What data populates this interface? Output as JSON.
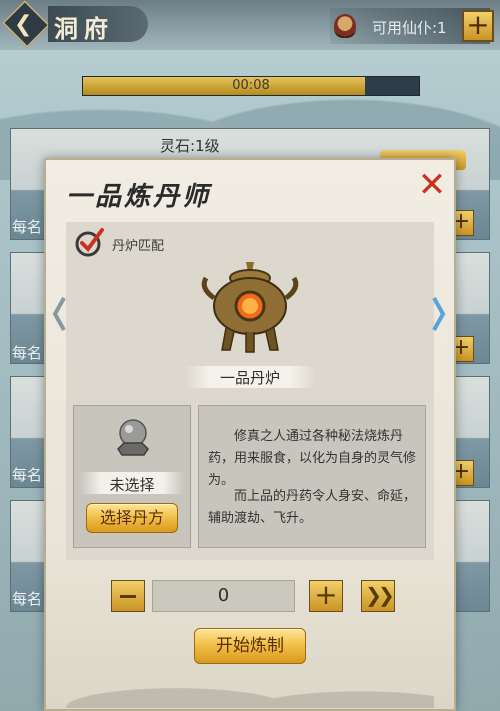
{
  "header": {
    "title": "洞府",
    "servants_label": "可用仙仆:1"
  },
  "timer": {
    "text": "00:08",
    "progress": 0.84
  },
  "background_cards": {
    "top_label": "灵石:1级",
    "row_label": "每名"
  },
  "dialog": {
    "title": "一品炼丹师",
    "match_label": "丹炉匹配",
    "furnace_name": "一品丹炉",
    "slot_status": "未选择",
    "choose_button": "选择丹方",
    "description_1": "修真之人通过各种秘法烧炼丹药，用来服食，以化为自身的灵气修为。",
    "description_2": "而上品的丹药令人身安、命延，辅助渡劫、飞升。",
    "quantity": "0",
    "start_button": "开始炼制"
  },
  "icons": [
    "back-arrow-icon",
    "servant-icon",
    "plus-icon",
    "close-icon",
    "check-icon",
    "furnace-icon",
    "orb-icon",
    "minus-icon",
    "double-chevron-icon",
    "chevron-left-icon",
    "chevron-right-icon"
  ],
  "colors": {
    "gold": "#f2c14a",
    "close_red": "#c8321e",
    "dialog_bg": "#f1ede3",
    "timer_fill": "#e7c35a"
  }
}
